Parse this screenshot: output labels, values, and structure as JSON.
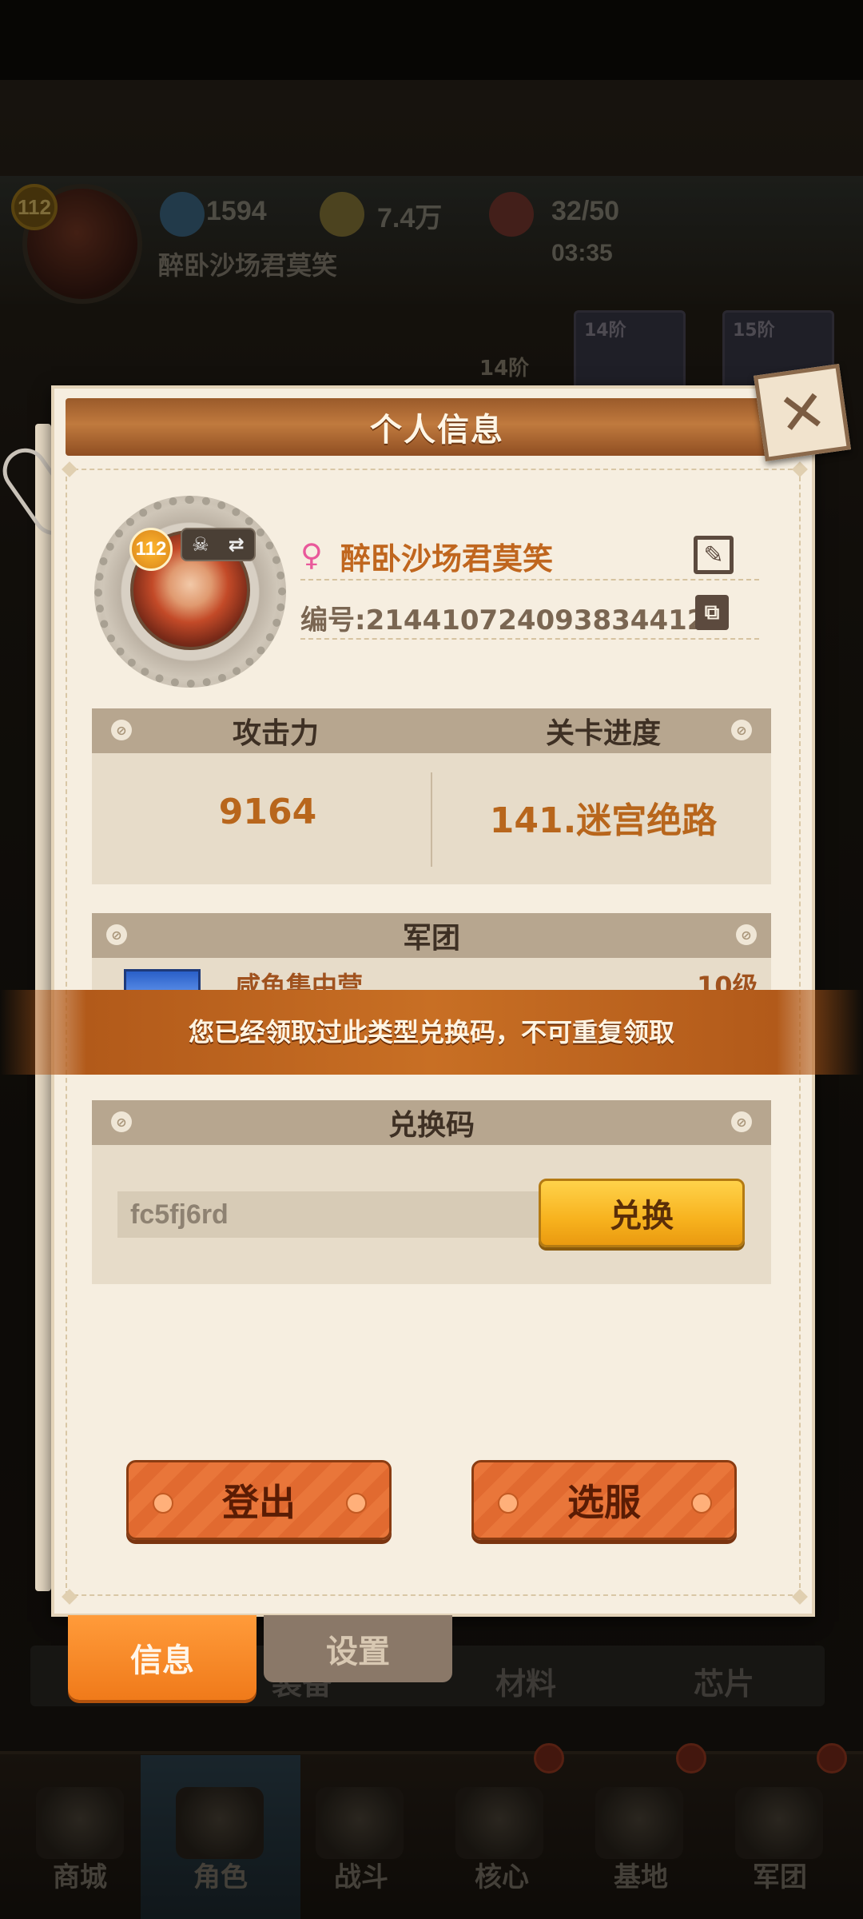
{
  "background": {
    "level": "112",
    "gems": "1594",
    "coins": "7.4万",
    "stamina": "32/50",
    "timer": "03:35",
    "player_name": "醉卧沙场君莫笑",
    "stage_badge": "14阶",
    "card_1": "14阶",
    "card_2": "15阶",
    "subtabs": [
      "装备",
      "材料",
      "芯片"
    ],
    "nav": [
      "商城",
      "角色",
      "战斗",
      "核心",
      "基地",
      "军团"
    ]
  },
  "dialog": {
    "title": "个人信息",
    "close_icon": "✕",
    "profile": {
      "level": "112",
      "name": "醉卧沙场君莫笑",
      "id_text": "编号:2144107240938344128"
    },
    "stats": {
      "attack_label": "攻击力",
      "attack_value": "9164",
      "progress_label": "关卡进度",
      "progress_value": "141.迷宫绝路"
    },
    "legion": {
      "title": "军团",
      "name": "咸鱼集中营",
      "level": "10级"
    },
    "redeem": {
      "title": "兑换码",
      "code_value": "fc5fj6rd",
      "button": "兑换"
    },
    "logout_button": "登出",
    "server_button": "选服"
  },
  "toast": {
    "message": "您已经领取过此类型兑换码，不可重复领取"
  },
  "tabs": {
    "info": "信息",
    "settings": "设置"
  }
}
